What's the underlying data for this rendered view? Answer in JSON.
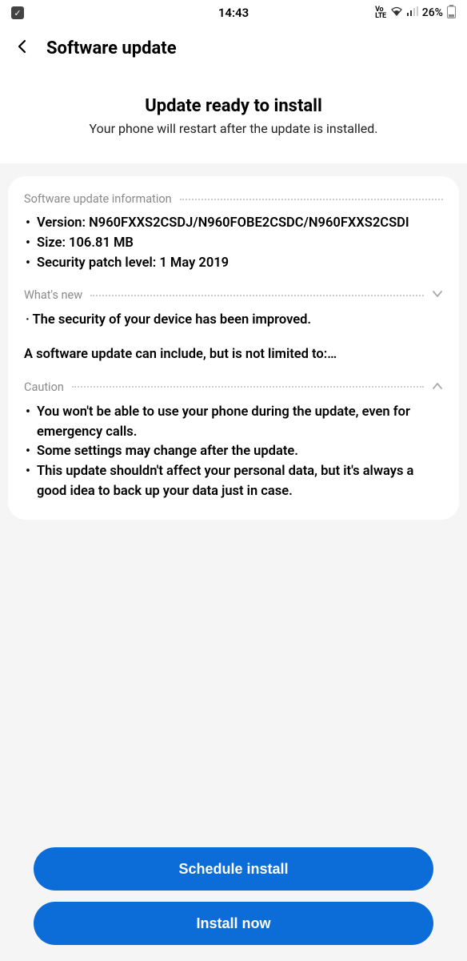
{
  "status": {
    "time": "14:43",
    "volte": "Vo\nLTE",
    "battery": "26%"
  },
  "header": {
    "title": "Software update"
  },
  "intro": {
    "title": "Update ready to install",
    "subtitle": "Your phone will restart after the update is installed."
  },
  "info": {
    "label": "Software update information",
    "version": "Version: N960FXXS2CSDJ/N960FOBE2CSDC/N960FXXS2CSDI",
    "size": "Size: 106.81 MB",
    "patch": "Security patch level: 1 May 2019"
  },
  "whatsnew": {
    "label": "What's new",
    "line": "The security of your device has been improved.",
    "paragraph": "A software update can include, but is not limited to:…"
  },
  "caution": {
    "label": "Caution",
    "items": [
      "You won't be able to use your phone during the update, even for emergency calls.",
      "Some settings may change after the update.",
      "This update shouldn't affect your personal data, but it's always a good idea to back up your data just in case."
    ]
  },
  "actions": {
    "schedule": "Schedule install",
    "install": "Install now"
  }
}
